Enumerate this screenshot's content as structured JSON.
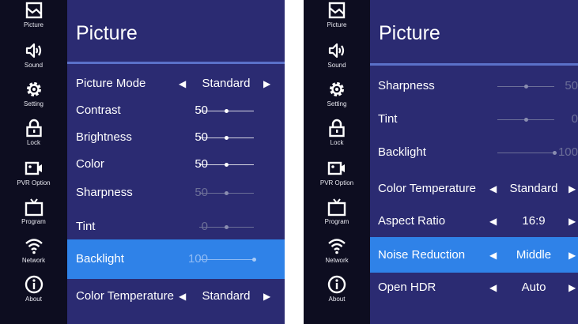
{
  "nav": [
    {
      "label": "Picture",
      "icon": "picture-icon"
    },
    {
      "label": "Sound",
      "icon": "sound-icon"
    },
    {
      "label": "Setting",
      "icon": "gear-icon"
    },
    {
      "label": "Lock",
      "icon": "lock-icon"
    },
    {
      "label": "PVR Option",
      "icon": "pvr-icon"
    },
    {
      "label": "Program",
      "icon": "tv-icon"
    },
    {
      "label": "Network",
      "icon": "wifi-icon"
    },
    {
      "label": "About",
      "icon": "info-icon"
    }
  ],
  "left_panel": {
    "title": "Picture",
    "items": [
      {
        "label": "Picture Mode",
        "type": "option",
        "value": "Standard"
      },
      {
        "label": "Contrast",
        "type": "slider",
        "value": "50",
        "level": 0.5
      },
      {
        "label": "Brightness",
        "type": "slider",
        "value": "50",
        "level": 0.5
      },
      {
        "label": "Color",
        "type": "slider",
        "value": "50",
        "level": 0.5
      },
      {
        "label": "Sharpness",
        "type": "slider",
        "value": "50",
        "level": 0.5,
        "dim": true
      },
      {
        "label": "Tint",
        "type": "slider",
        "value": "0",
        "level": 0.5,
        "dim": true
      },
      {
        "label": "Backlight",
        "type": "slider",
        "value": "100",
        "level": 1.0,
        "dim": true,
        "selected": true
      },
      {
        "label": "Color Temperature",
        "type": "option",
        "value": "Standard"
      }
    ]
  },
  "right_panel": {
    "title": "Picture",
    "items": [
      {
        "label": "Sharpness",
        "type": "slider",
        "value": "50",
        "level": 0.5,
        "dim": true
      },
      {
        "label": "Tint",
        "type": "slider",
        "value": "0",
        "level": 0.5,
        "dim": true
      },
      {
        "label": "Backlight",
        "type": "slider",
        "value": "100",
        "level": 1.0,
        "dim": true
      },
      {
        "label": "Color Temperature",
        "type": "option",
        "value": "Standard"
      },
      {
        "label": "Aspect Ratio",
        "type": "option",
        "value": "16:9"
      },
      {
        "label": "Noise Reduction",
        "type": "option",
        "value": "Middle",
        "selected": true
      },
      {
        "label": "Open HDR",
        "type": "option",
        "value": "Auto"
      }
    ]
  },
  "colors": {
    "sidebar": "#0d0d20",
    "content": "#2b2b72",
    "highlight": "#2f82e8",
    "divider": "#5b71c9"
  }
}
